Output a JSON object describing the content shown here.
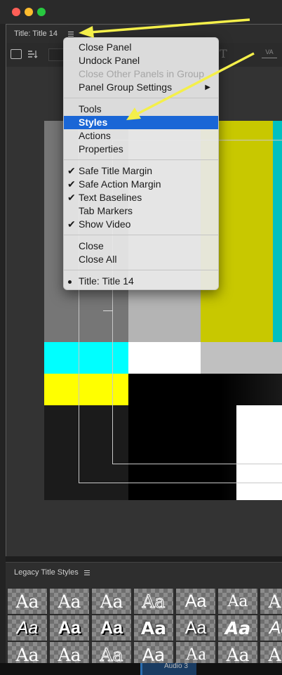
{
  "colors": {
    "menu_highlight": "#1a66d6",
    "arrow_annotation": "#f4ef4a",
    "cyan": "#00ffff",
    "yellow": "#ffff00",
    "olive": "#c8c800"
  },
  "panel": {
    "title": "Title: Title 14",
    "menu_icon": "hamburger-menu-icon"
  },
  "context_menu": {
    "items": [
      {
        "label": "Close Panel",
        "state": "normal"
      },
      {
        "label": "Undock Panel",
        "state": "normal"
      },
      {
        "label": "Close Other Panels in Group",
        "state": "disabled"
      },
      {
        "label": "Panel Group Settings",
        "state": "normal",
        "submenu": "▶"
      },
      {
        "label": "Tools",
        "state": "normal"
      },
      {
        "label": "Styles",
        "state": "highlighted"
      },
      {
        "label": "Actions",
        "state": "normal"
      },
      {
        "label": "Properties",
        "state": "normal"
      },
      {
        "label": "Safe Title Margin",
        "state": "checked",
        "check": "✔"
      },
      {
        "label": "Safe Action Margin",
        "state": "checked",
        "check": "✔"
      },
      {
        "label": "Text Baselines",
        "state": "checked",
        "check": "✔"
      },
      {
        "label": "Tab Markers",
        "state": "normal"
      },
      {
        "label": "Show Video",
        "state": "checked",
        "check": "✔"
      },
      {
        "label": "Close",
        "state": "normal"
      },
      {
        "label": "Close All",
        "state": "normal"
      },
      {
        "label": "Title: Title 14",
        "state": "bulleted"
      }
    ]
  },
  "styles_panel": {
    "title": "Legacy Title Styles",
    "swatch_text": "Aa"
  },
  "timeline": {
    "track_label": "Audio 3"
  }
}
